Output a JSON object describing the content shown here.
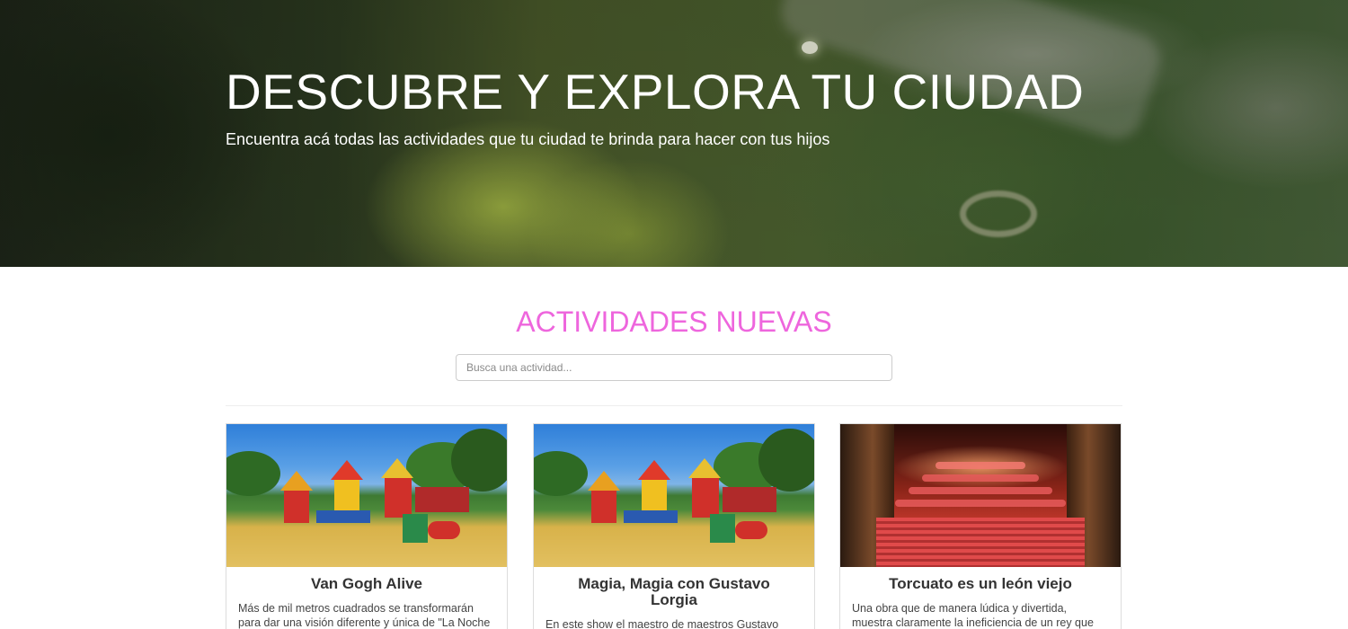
{
  "hero": {
    "title": "DESCUBRE Y EXPLORA TU CIUDAD",
    "subtitle": "Encuentra acá todas las actividades que tu ciudad te brinda para hacer con tus hijos"
  },
  "section": {
    "title": "ACTIVIDADES NUEVAS",
    "title_color": "#ee66dd"
  },
  "search": {
    "placeholder": "Busca una actividad..."
  },
  "activities": [
    {
      "title": "Van Gogh Alive",
      "description": "Más de mil metros cuadrados se transformarán para dar una visión diferente y única de \"La Noche",
      "image": "playground-photo"
    },
    {
      "title": "Magia, Magia con Gustavo Lorgia",
      "description": "En este show el maestro de maestros Gustavo",
      "image": "playground-photo"
    },
    {
      "title": "Torcuato es un león viejo",
      "description": "Una obra que de manera lúdica y divertida, muestra claramente la ineficiencia de un rey que sólo vive",
      "image": "theater-photo"
    }
  ]
}
